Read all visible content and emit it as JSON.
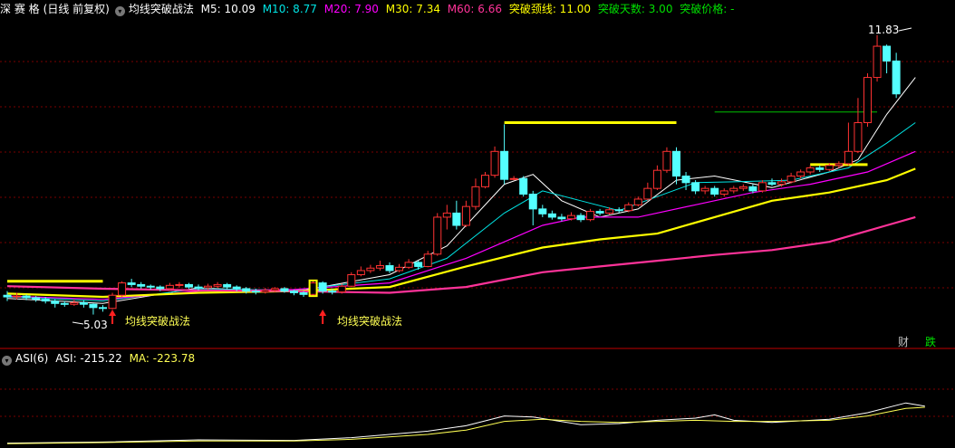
{
  "header": {
    "symbol": "深 赛 格",
    "period": "(日线 前复权)",
    "indicator": "均线突破战法",
    "m5_label": "M5: 10.09",
    "m10_label": "M10: 8.77",
    "m20_label": "M20: 7.90",
    "m30_label": "M30: 7.34",
    "m60_label": "M60: 6.66",
    "neck_label": "突破颈线: 11.00",
    "days_label": "突破天数: 3.00",
    "price_label": "突破价格: -"
  },
  "sub_header": {
    "indicator": "ASI(6)",
    "asi_label": "ASI: -215.22",
    "ma_label": "MA: -223.78"
  },
  "annotations": {
    "high_price": "11.83",
    "low_price": "5.03",
    "signal1": "均线突破战法",
    "signal2": "均线突破战法"
  },
  "buttons": {
    "cai": "财",
    "die": "跌"
  },
  "colors": {
    "up": "#ff3232",
    "down": "#54ffff",
    "m5": "#ffffff",
    "m10": "#00e4e4",
    "m20": "#ff00ff",
    "m30": "#ffff00",
    "m60": "#ff3399",
    "grid": "#7a0000",
    "neck": "#ffff00",
    "green_line": "#00c000"
  },
  "chart_data": {
    "type": "candlestick",
    "ylim": [
      4.8,
      12.2
    ],
    "candles": [
      [
        5.5,
        5.46,
        5.6,
        5.36
      ],
      [
        5.46,
        5.48,
        5.56,
        5.4
      ],
      [
        5.48,
        5.44,
        5.52,
        5.38
      ],
      [
        5.44,
        5.4,
        5.48,
        5.34
      ],
      [
        5.4,
        5.36,
        5.46,
        5.3
      ],
      [
        5.36,
        5.3,
        5.4,
        5.2
      ],
      [
        5.3,
        5.28,
        5.36,
        5.22
      ],
      [
        5.28,
        5.32,
        5.4,
        5.24
      ],
      [
        5.32,
        5.28,
        5.38,
        5.2
      ],
      [
        5.28,
        5.2,
        5.3,
        5.03
      ],
      [
        5.2,
        5.18,
        5.26,
        5.1
      ],
      [
        5.18,
        5.5,
        5.56,
        5.16
      ],
      [
        5.5,
        5.8,
        5.84,
        5.46
      ],
      [
        5.8,
        5.76,
        5.9,
        5.7
      ],
      [
        5.76,
        5.72,
        5.82,
        5.66
      ],
      [
        5.72,
        5.7,
        5.76,
        5.64
      ],
      [
        5.7,
        5.66,
        5.74,
        5.6
      ],
      [
        5.66,
        5.74,
        5.8,
        5.62
      ],
      [
        5.74,
        5.76,
        5.82,
        5.68
      ],
      [
        5.76,
        5.7,
        5.8,
        5.66
      ],
      [
        5.7,
        5.68,
        5.76,
        5.62
      ],
      [
        5.68,
        5.72,
        5.78,
        5.64
      ],
      [
        5.72,
        5.76,
        5.82,
        5.68
      ],
      [
        5.76,
        5.7,
        5.8,
        5.64
      ],
      [
        5.7,
        5.66,
        5.74,
        5.6
      ],
      [
        5.66,
        5.6,
        5.7,
        5.54
      ],
      [
        5.6,
        5.58,
        5.66,
        5.52
      ],
      [
        5.58,
        5.62,
        5.68,
        5.54
      ],
      [
        5.62,
        5.66,
        5.7,
        5.58
      ],
      [
        5.66,
        5.6,
        5.7,
        5.56
      ],
      [
        5.6,
        5.56,
        5.64,
        5.5
      ],
      [
        5.56,
        5.52,
        5.6,
        5.46
      ],
      [
        5.52,
        5.8,
        5.86,
        5.48
      ],
      [
        5.8,
        5.6,
        5.84,
        5.54
      ],
      [
        5.6,
        5.58,
        5.66,
        5.52
      ],
      [
        5.58,
        5.72,
        5.78,
        5.54
      ],
      [
        5.72,
        6.0,
        6.06,
        5.7
      ],
      [
        6.0,
        6.1,
        6.2,
        5.96
      ],
      [
        6.1,
        6.16,
        6.24,
        6.04
      ],
      [
        6.16,
        6.22,
        6.34,
        6.1
      ],
      [
        6.22,
        6.1,
        6.3,
        6.04
      ],
      [
        6.1,
        6.18,
        6.26,
        6.06
      ],
      [
        6.18,
        6.3,
        6.38,
        6.14
      ],
      [
        6.3,
        6.2,
        6.34,
        6.12
      ],
      [
        6.2,
        6.5,
        6.58,
        6.18
      ],
      [
        6.5,
        7.4,
        7.5,
        6.46
      ],
      [
        7.4,
        7.5,
        7.7,
        7.1
      ],
      [
        7.5,
        7.2,
        7.8,
        7.1
      ],
      [
        7.2,
        7.66,
        7.8,
        7.16
      ],
      [
        7.66,
        8.14,
        8.34,
        7.58
      ],
      [
        8.14,
        8.42,
        8.5,
        8.1
      ],
      [
        8.42,
        9.0,
        9.12,
        8.36
      ],
      [
        9.0,
        8.32,
        9.66,
        8.2
      ],
      [
        8.32,
        8.34,
        8.4,
        8.3
      ],
      [
        8.34,
        7.96,
        8.4,
        7.9
      ],
      [
        7.96,
        7.6,
        8.04,
        7.2
      ],
      [
        7.6,
        7.48,
        7.7,
        7.4
      ],
      [
        7.48,
        7.4,
        7.56,
        7.34
      ],
      [
        7.4,
        7.36,
        7.48,
        7.3
      ],
      [
        7.36,
        7.44,
        7.52,
        7.32
      ],
      [
        7.44,
        7.34,
        7.5,
        7.28
      ],
      [
        7.34,
        7.54,
        7.6,
        7.3
      ],
      [
        7.54,
        7.5,
        7.6,
        7.44
      ],
      [
        7.5,
        7.58,
        7.64,
        7.46
      ],
      [
        7.58,
        7.56,
        7.64,
        7.5
      ],
      [
        7.56,
        7.7,
        7.76,
        7.52
      ],
      [
        7.7,
        7.84,
        7.9,
        7.66
      ],
      [
        7.84,
        8.1,
        8.24,
        7.8
      ],
      [
        8.1,
        8.54,
        8.66,
        8.06
      ],
      [
        8.54,
        9.0,
        9.1,
        8.48
      ],
      [
        9.0,
        8.4,
        9.1,
        8.2
      ],
      [
        8.4,
        8.24,
        8.5,
        8.06
      ],
      [
        8.24,
        8.04,
        8.3,
        7.96
      ],
      [
        8.04,
        8.1,
        8.16,
        7.96
      ],
      [
        8.1,
        7.96,
        8.16,
        7.9
      ],
      [
        7.96,
        8.04,
        8.1,
        7.9
      ],
      [
        8.04,
        8.1,
        8.16,
        7.98
      ],
      [
        8.1,
        8.14,
        8.2,
        8.04
      ],
      [
        8.14,
        8.04,
        8.2,
        7.98
      ],
      [
        8.04,
        8.24,
        8.3,
        8.0
      ],
      [
        8.24,
        8.2,
        8.34,
        8.16
      ],
      [
        8.2,
        8.26,
        8.34,
        8.14
      ],
      [
        8.26,
        8.4,
        8.48,
        8.22
      ],
      [
        8.4,
        8.5,
        8.56,
        8.34
      ],
      [
        8.5,
        8.6,
        8.66,
        8.44
      ],
      [
        8.6,
        8.56,
        8.66,
        8.5
      ],
      [
        8.56,
        8.66,
        8.72,
        8.52
      ],
      [
        8.66,
        8.7,
        8.76,
        8.6
      ],
      [
        8.7,
        9.0,
        9.7,
        8.66
      ],
      [
        9.0,
        9.7,
        10.3,
        8.96
      ],
      [
        9.7,
        10.8,
        10.9,
        9.6
      ],
      [
        10.8,
        11.56,
        11.83,
        10.7
      ],
      [
        11.56,
        11.2,
        11.6,
        10.9
      ],
      [
        11.2,
        10.4,
        11.4,
        10.3
      ]
    ],
    "ma_lines": {
      "m5": [
        [
          0,
          5.42
        ],
        [
          10,
          5.3
        ],
        [
          20,
          5.68
        ],
        [
          30,
          5.58
        ],
        [
          40,
          6.0
        ],
        [
          46,
          6.7
        ],
        [
          52,
          8.2
        ],
        [
          55,
          8.44
        ],
        [
          58,
          7.8
        ],
        [
          62,
          7.4
        ],
        [
          66,
          7.6
        ],
        [
          70,
          8.3
        ],
        [
          74,
          8.4
        ],
        [
          80,
          8.12
        ],
        [
          86,
          8.5
        ],
        [
          89,
          8.8
        ],
        [
          92,
          9.9
        ],
        [
          95,
          10.8
        ]
      ],
      "m10": [
        [
          0,
          5.46
        ],
        [
          10,
          5.36
        ],
        [
          20,
          5.66
        ],
        [
          30,
          5.62
        ],
        [
          40,
          5.9
        ],
        [
          46,
          6.4
        ],
        [
          52,
          7.5
        ],
        [
          56,
          8.04
        ],
        [
          60,
          7.8
        ],
        [
          64,
          7.56
        ],
        [
          68,
          7.9
        ],
        [
          72,
          8.24
        ],
        [
          76,
          8.26
        ],
        [
          82,
          8.3
        ],
        [
          88,
          8.6
        ],
        [
          92,
          9.2
        ],
        [
          95,
          9.7
        ]
      ],
      "m20": [
        [
          0,
          5.48
        ],
        [
          10,
          5.4
        ],
        [
          20,
          5.6
        ],
        [
          30,
          5.64
        ],
        [
          40,
          5.8
        ],
        [
          48,
          6.4
        ],
        [
          56,
          7.2
        ],
        [
          60,
          7.4
        ],
        [
          66,
          7.4
        ],
        [
          72,
          7.7
        ],
        [
          78,
          8.0
        ],
        [
          84,
          8.2
        ],
        [
          90,
          8.5
        ],
        [
          95,
          9.0
        ]
      ],
      "m30": [
        [
          0,
          5.54
        ],
        [
          10,
          5.46
        ],
        [
          20,
          5.56
        ],
        [
          30,
          5.6
        ],
        [
          40,
          5.7
        ],
        [
          48,
          6.2
        ],
        [
          56,
          6.66
        ],
        [
          62,
          6.86
        ],
        [
          68,
          7.0
        ],
        [
          74,
          7.4
        ],
        [
          80,
          7.8
        ],
        [
          86,
          8.0
        ],
        [
          92,
          8.3
        ],
        [
          95,
          8.58
        ]
      ],
      "m60": [
        [
          0,
          5.72
        ],
        [
          10,
          5.66
        ],
        [
          20,
          5.62
        ],
        [
          30,
          5.6
        ],
        [
          40,
          5.56
        ],
        [
          48,
          5.7
        ],
        [
          56,
          6.06
        ],
        [
          62,
          6.2
        ],
        [
          68,
          6.34
        ],
        [
          74,
          6.48
        ],
        [
          80,
          6.6
        ],
        [
          86,
          6.8
        ],
        [
          92,
          7.2
        ],
        [
          95,
          7.4
        ]
      ]
    },
    "asi_ylim": [
      -300,
      -150
    ],
    "asi": [
      [
        0,
        -296
      ],
      [
        10,
        -294
      ],
      [
        20,
        -290
      ],
      [
        30,
        -291
      ],
      [
        36,
        -286
      ],
      [
        44,
        -274
      ],
      [
        48,
        -264
      ],
      [
        52,
        -246
      ],
      [
        55,
        -248
      ],
      [
        60,
        -262
      ],
      [
        64,
        -260
      ],
      [
        68,
        -254
      ],
      [
        72,
        -250
      ],
      [
        74,
        -244
      ],
      [
        76,
        -254
      ],
      [
        80,
        -258
      ],
      [
        86,
        -252
      ],
      [
        90,
        -240
      ],
      [
        94,
        -222
      ],
      [
        96,
        -228
      ]
    ],
    "asi_ma": [
      [
        0,
        -297
      ],
      [
        10,
        -295
      ],
      [
        20,
        -292
      ],
      [
        30,
        -292
      ],
      [
        36,
        -289
      ],
      [
        44,
        -280
      ],
      [
        48,
        -272
      ],
      [
        52,
        -256
      ],
      [
        56,
        -252
      ],
      [
        60,
        -256
      ],
      [
        64,
        -258
      ],
      [
        68,
        -256
      ],
      [
        72,
        -254
      ],
      [
        76,
        -256
      ],
      [
        80,
        -256
      ],
      [
        86,
        -254
      ],
      [
        90,
        -246
      ],
      [
        94,
        -232
      ],
      [
        96,
        -230
      ]
    ],
    "neckline_segments": [
      [
        52,
        70,
        9.7
      ],
      [
        84,
        90,
        8.68
      ],
      [
        0,
        10,
        5.84
      ]
    ],
    "green_segment": [
      74,
      91,
      9.96
    ]
  }
}
